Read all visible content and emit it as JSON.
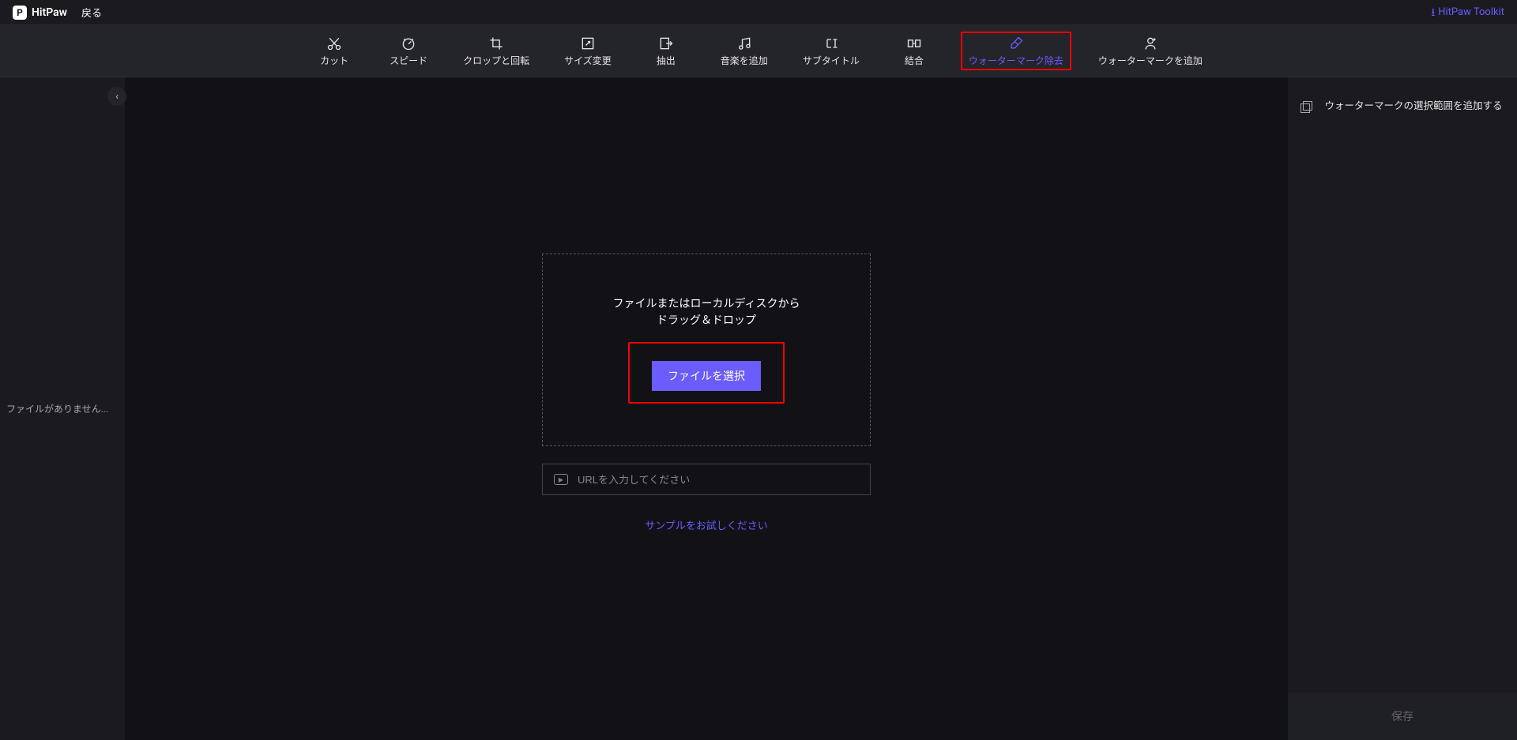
{
  "titlebar": {
    "app_name": "HitPaw",
    "back_label": "戻る",
    "toolkit_label": "HitPaw Toolkit"
  },
  "toolbar": {
    "items": [
      {
        "id": "cut",
        "label": "カット",
        "icon": "cut-icon"
      },
      {
        "id": "speed",
        "label": "スピード",
        "icon": "speed-icon"
      },
      {
        "id": "crop-rotate",
        "label": "クロップと回転",
        "icon": "crop-rotate-icon"
      },
      {
        "id": "resize",
        "label": "サイズ変更",
        "icon": "resize-icon"
      },
      {
        "id": "extract",
        "label": "抽出",
        "icon": "extract-icon"
      },
      {
        "id": "add-music",
        "label": "音楽を追加",
        "icon": "music-icon"
      },
      {
        "id": "subtitle",
        "label": "サブタイトル",
        "icon": "subtitle-icon"
      },
      {
        "id": "merge",
        "label": "結合",
        "icon": "merge-icon"
      },
      {
        "id": "wm-remove",
        "label": "ウォーターマーク除去",
        "icon": "eraser-icon",
        "active": true
      },
      {
        "id": "wm-add",
        "label": "ウォーターマークを追加",
        "icon": "watermark-add-icon"
      }
    ]
  },
  "left_panel": {
    "no_files_label": "ファイルがありません..."
  },
  "center": {
    "drop_line1": "ファイルまたはローカルディスクから",
    "drop_line2": "ドラッグ＆ドロップ",
    "select_button": "ファイルを選択",
    "url_placeholder": "URLを入力してください",
    "sample_link": "サンプルをお試しください"
  },
  "right_panel": {
    "add_selection_label": "ウォーターマークの選択範囲を追加する",
    "save_label": "保存"
  },
  "colors": {
    "accent": "#6a5cff",
    "highlight": "#ff0000"
  }
}
